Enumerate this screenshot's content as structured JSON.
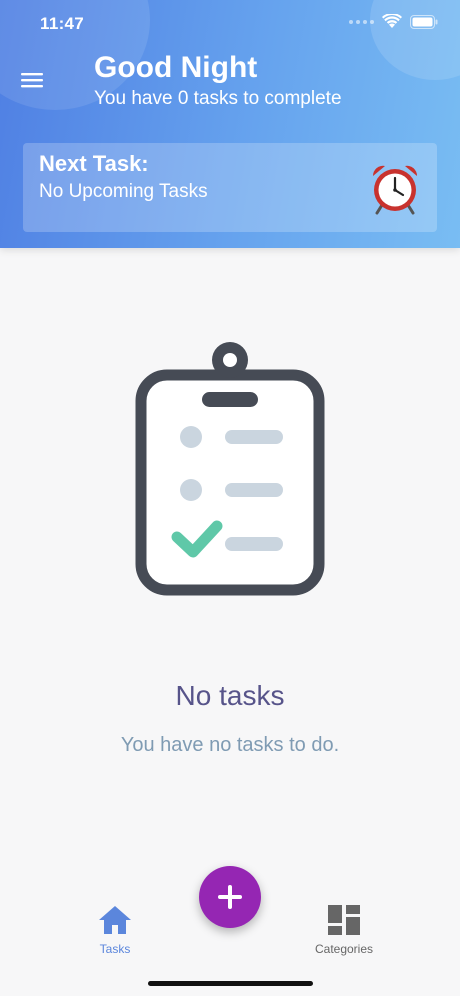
{
  "status_bar": {
    "time": "11:47",
    "icons": [
      "signal-dots-icon",
      "wifi-icon",
      "battery-icon"
    ]
  },
  "header": {
    "greeting": "Good Night",
    "task_summary": "You have 0 tasks to complete",
    "menu_icon": "hamburger-menu-icon"
  },
  "next_task_card": {
    "title": "Next Task:",
    "subtitle": "No Upcoming Tasks",
    "icon": "alarm-clock-icon"
  },
  "empty_state": {
    "illustration": "clipboard-checklist-icon",
    "title": "No tasks",
    "subtitle": "You have no tasks to do."
  },
  "bottom_nav": {
    "items": [
      {
        "label": "Tasks",
        "icon": "home-icon",
        "active": true
      },
      {
        "label": "Categories",
        "icon": "dashboard-grid-icon",
        "active": false
      }
    ],
    "fab_icon": "plus-icon"
  },
  "colors": {
    "header_gradient_start": "#4f7fe3",
    "header_gradient_end": "#79bdf3",
    "fab": "#9526b3",
    "active_tab": "#5b86dc",
    "empty_title": "#57548a",
    "empty_subtitle": "#7f9bb3",
    "checkmark": "#5fc8a8"
  }
}
